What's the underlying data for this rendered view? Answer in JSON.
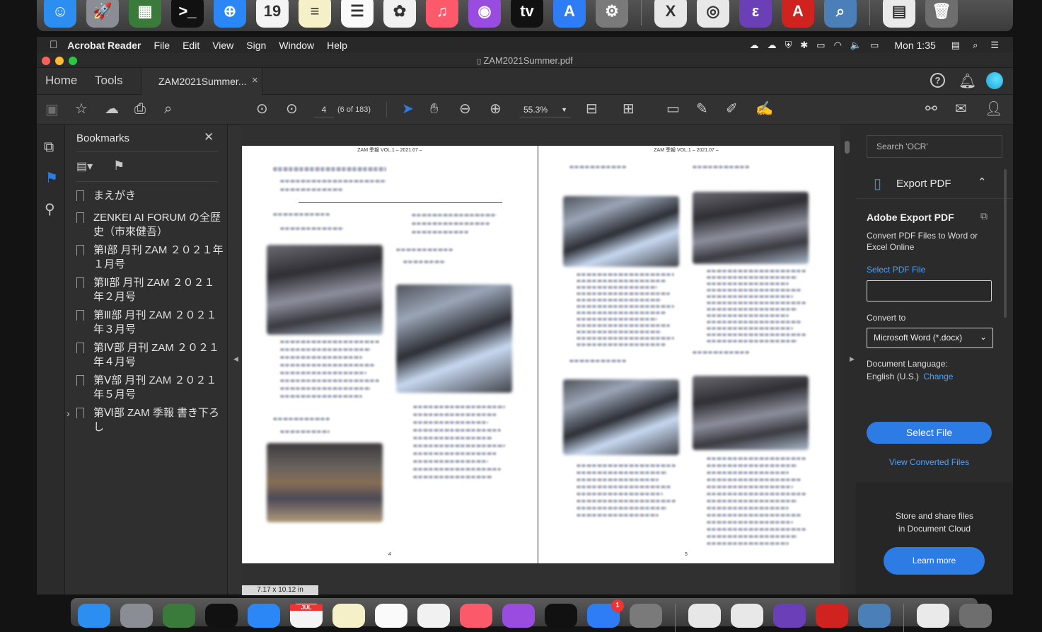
{
  "dock_top": {
    "apps": [
      {
        "name": "finder",
        "color": "#2b8ef0",
        "glyph": "☺"
      },
      {
        "name": "launchpad",
        "color": "#8a8d93",
        "glyph": "🚀"
      },
      {
        "name": "activity",
        "color": "#3a7a3a",
        "glyph": "▦"
      },
      {
        "name": "terminal",
        "color": "#111",
        "glyph": ">_"
      },
      {
        "name": "safari",
        "color": "#2a87f5",
        "glyph": "⊕"
      },
      {
        "name": "calendar",
        "color": "#f4f4f4",
        "glyph": "19"
      },
      {
        "name": "notes",
        "color": "#f6f0c8",
        "glyph": "≡"
      },
      {
        "name": "reminders",
        "color": "#fafafa",
        "glyph": "☰"
      },
      {
        "name": "photos",
        "color": "#f1f1f1",
        "glyph": "✿"
      },
      {
        "name": "music",
        "color": "#fc5a6b",
        "glyph": "♫"
      },
      {
        "name": "podcasts",
        "color": "#9b4ce0",
        "glyph": "◉"
      },
      {
        "name": "tv",
        "color": "#111",
        "glyph": "tv"
      },
      {
        "name": "appstore",
        "color": "#2f7df6",
        "glyph": "A"
      },
      {
        "name": "settings",
        "color": "#7a7a7a",
        "glyph": "⚙"
      },
      {
        "name": "xquartz",
        "color": "#e7e7e7",
        "glyph": "X"
      },
      {
        "name": "chrome",
        "color": "#e8e8e8",
        "glyph": "◎"
      },
      {
        "name": "emacs",
        "color": "#6a3fb8",
        "glyph": "ε"
      },
      {
        "name": "acrobat",
        "color": "#d0231f",
        "glyph": "A"
      },
      {
        "name": "preview",
        "color": "#4b7fb7",
        "glyph": "⌕"
      },
      {
        "name": "document",
        "color": "#eaeaea",
        "glyph": "▤"
      },
      {
        "name": "trash",
        "color": "#6e6e6e",
        "glyph": "🗑"
      }
    ]
  },
  "dock_bottom": {
    "calendar_month": "JUL",
    "badge": "1"
  },
  "menubar": {
    "app_name": "Acrobat Reader",
    "menus": [
      "File",
      "Edit",
      "View",
      "Sign",
      "Window",
      "Help"
    ],
    "clock": "Mon 1:35"
  },
  "window": {
    "title": "ZAM2021Summer.pdf",
    "tabs": {
      "home": "Home",
      "tools": "Tools",
      "doc_tab": "ZAM2021Summer...",
      "close": "×"
    },
    "toolbar": {
      "page_input": "4",
      "page_of": "(6 of 183)",
      "zoom": "55.3%"
    }
  },
  "bookmarks": {
    "title": "Bookmarks",
    "close": "✕",
    "items": [
      {
        "label": "まえがき",
        "expandable": false
      },
      {
        "label": "ZENKEI AI FORUM の全歴史（市來健吾）",
        "expandable": false
      },
      {
        "label": "第Ⅰ部 月刊 ZAM ２０２１年１月号",
        "expandable": false
      },
      {
        "label": "第Ⅱ部 月刊 ZAM ２０２１年２月号",
        "expandable": false
      },
      {
        "label": "第Ⅲ部 月刊 ZAM ２０２１年３月号",
        "expandable": false
      },
      {
        "label": "第Ⅳ部 月刊 ZAM ２０２１年４月号",
        "expandable": false
      },
      {
        "label": "第Ⅴ部 月刊 ZAM ２０２１年５月号",
        "expandable": false
      },
      {
        "label": "第Ⅵ部 ZAM 季報 書き下ろし",
        "expandable": true
      }
    ]
  },
  "document": {
    "left_page": {
      "header": "ZAM 季報 VOL.1 – 2021.07 –",
      "number": "4"
    },
    "right_page": {
      "header": "ZAM 季報 VOL.1 – 2021.07 –",
      "number": "5"
    },
    "page_size": "7.17 x 10.12 in"
  },
  "right_panel": {
    "search_placeholder": "Search 'OCR'",
    "export_title": "Export PDF",
    "heading": "Adobe Export PDF",
    "desc": "Convert PDF Files to Word or Excel Online",
    "select_pdf_label": "Select PDF File",
    "convert_to_label": "Convert to",
    "convert_option": "Microsoft Word (*.docx)",
    "doc_language_label": "Document Language:",
    "doc_language_value": "English (U.S.)",
    "change_link": "Change",
    "select_file_button": "Select File",
    "view_converted": "View Converted Files",
    "cloud_text": "Store and share files in Document Cloud",
    "learn_more": "Learn more"
  },
  "colors": {
    "accent": "#2d7be5",
    "link": "#4aa3ff",
    "panel": "#2b2b2b"
  }
}
